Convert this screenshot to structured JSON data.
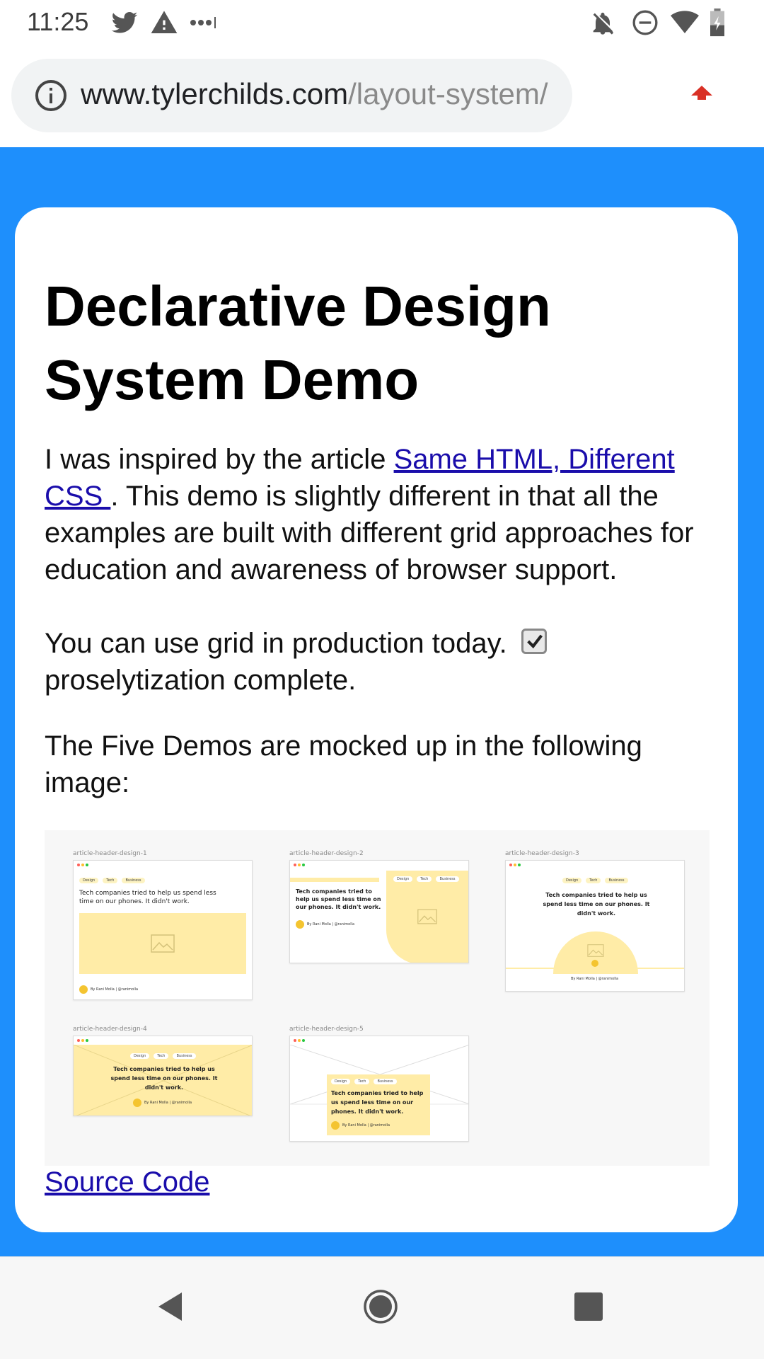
{
  "status_bar": {
    "time": "11:25",
    "left_icons": [
      "twitter-icon",
      "warning-icon",
      "more-icon"
    ],
    "right_icons": [
      "notifications-off-icon",
      "do-not-disturb-icon",
      "wifi-icon",
      "battery-icon"
    ]
  },
  "url_bar": {
    "domain": "www.tylerchilds.com",
    "path": "/layout-system/",
    "info_icon": "info-icon",
    "upload_icon": "upload-arrow-icon",
    "accent_color": "#d93025"
  },
  "page": {
    "background_color": "#1e8ffc",
    "title": "Declarative Design System Demo",
    "intro_before": "I was inspired by the article ",
    "intro_link": "Same HTML, Different CSS ",
    "intro_after": ". This demo is slightly different in that all the examples are built with different grid approaches for education and awareness of browser support.",
    "grid_text": "You can use grid in production today.",
    "grid_checked": true,
    "grid_after": "proselytization complete.",
    "demos_text": "The Five Demos are mocked up in the following image:",
    "source_link": "Source Code"
  },
  "mockup": {
    "designs": [
      {
        "label": "article-header-design-1"
      },
      {
        "label": "article-header-design-2"
      },
      {
        "label": "article-header-design-3"
      },
      {
        "label": "article-header-design-4"
      },
      {
        "label": "article-header-design-5"
      }
    ],
    "tags": [
      "Design",
      "Tech",
      "Business"
    ],
    "headline": "Tech companies tried to help us spend less time on our phones. It didn't work.",
    "byline": "By Rani Molla  |  @ranimolla",
    "yellow": "#ffeca7"
  },
  "nav_bar": {
    "icons": [
      "back-icon",
      "home-icon",
      "recents-icon"
    ]
  }
}
